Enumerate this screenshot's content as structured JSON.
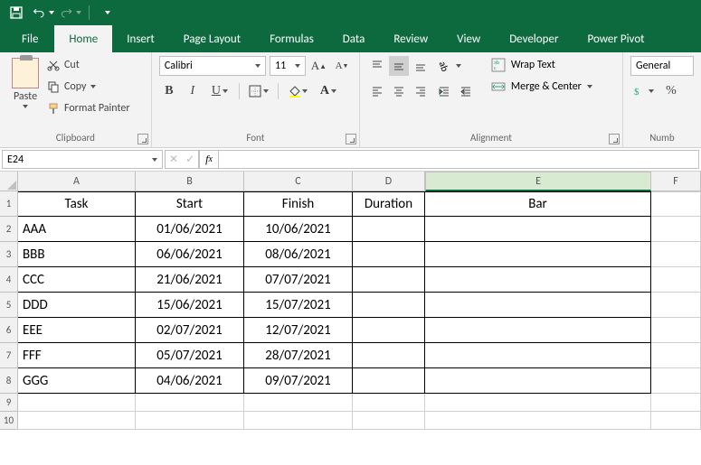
{
  "tabs": [
    "File",
    "Home",
    "Insert",
    "Page Layout",
    "Formulas",
    "Data",
    "Review",
    "View",
    "Developer",
    "Power Pivot"
  ],
  "active_tab": "Home",
  "clipboard": {
    "paste": "Paste",
    "cut": "Cut",
    "copy": "Copy",
    "format_painter": "Format Painter",
    "group": "Clipboard"
  },
  "font": {
    "name": "Calibri",
    "size": "11",
    "group": "Font"
  },
  "alignment": {
    "wrap": "Wrap Text",
    "merge": "Merge & Center",
    "group": "Alignment"
  },
  "number": {
    "format": "General",
    "group": "Numb"
  },
  "namebox": "E24",
  "columns": [
    "A",
    "B",
    "C",
    "D",
    "E",
    "F"
  ],
  "headers": {
    "A": "Task",
    "B": "Start",
    "C": "Finish",
    "D": "Duration",
    "E": "Bar"
  },
  "rows": [
    {
      "A": "AAA",
      "B": "01/06/2021",
      "C": "10/06/2021",
      "D": "",
      "E": ""
    },
    {
      "A": "BBB",
      "B": "06/06/2021",
      "C": "08/06/2021",
      "D": "",
      "E": ""
    },
    {
      "A": "CCC",
      "B": "21/06/2021",
      "C": "07/07/2021",
      "D": "",
      "E": ""
    },
    {
      "A": "DDD",
      "B": "15/06/2021",
      "C": "15/07/2021",
      "D": "",
      "E": ""
    },
    {
      "A": "EEE",
      "B": "02/07/2021",
      "C": "12/07/2021",
      "D": "",
      "E": ""
    },
    {
      "A": "FFF",
      "B": "05/07/2021",
      "C": "28/07/2021",
      "D": "",
      "E": ""
    },
    {
      "A": "GGG",
      "B": "04/06/2021",
      "C": "09/07/2021",
      "D": "",
      "E": ""
    }
  ],
  "extra_rows": [
    9,
    10
  ]
}
